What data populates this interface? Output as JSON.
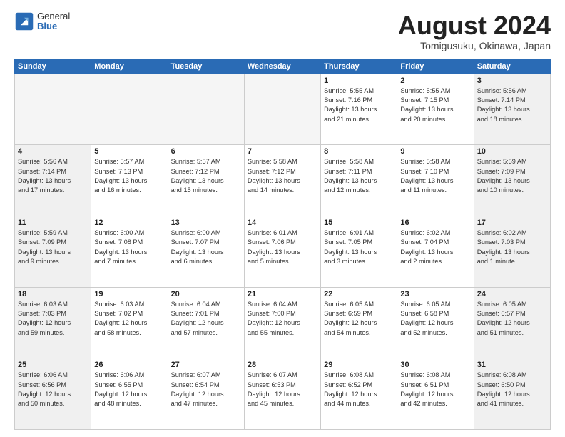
{
  "logo": {
    "general": "General",
    "blue": "Blue"
  },
  "title": "August 2024",
  "location": "Tomigusuku, Okinawa, Japan",
  "weekdays": [
    "Sunday",
    "Monday",
    "Tuesday",
    "Wednesday",
    "Thursday",
    "Friday",
    "Saturday"
  ],
  "weeks": [
    [
      {
        "day": "",
        "info": ""
      },
      {
        "day": "",
        "info": ""
      },
      {
        "day": "",
        "info": ""
      },
      {
        "day": "",
        "info": ""
      },
      {
        "day": "1",
        "info": "Sunrise: 5:55 AM\nSunset: 7:16 PM\nDaylight: 13 hours\nand 21 minutes."
      },
      {
        "day": "2",
        "info": "Sunrise: 5:55 AM\nSunset: 7:15 PM\nDaylight: 13 hours\nand 20 minutes."
      },
      {
        "day": "3",
        "info": "Sunrise: 5:56 AM\nSunset: 7:14 PM\nDaylight: 13 hours\nand 18 minutes."
      }
    ],
    [
      {
        "day": "4",
        "info": "Sunrise: 5:56 AM\nSunset: 7:14 PM\nDaylight: 13 hours\nand 17 minutes."
      },
      {
        "day": "5",
        "info": "Sunrise: 5:57 AM\nSunset: 7:13 PM\nDaylight: 13 hours\nand 16 minutes."
      },
      {
        "day": "6",
        "info": "Sunrise: 5:57 AM\nSunset: 7:12 PM\nDaylight: 13 hours\nand 15 minutes."
      },
      {
        "day": "7",
        "info": "Sunrise: 5:58 AM\nSunset: 7:12 PM\nDaylight: 13 hours\nand 14 minutes."
      },
      {
        "day": "8",
        "info": "Sunrise: 5:58 AM\nSunset: 7:11 PM\nDaylight: 13 hours\nand 12 minutes."
      },
      {
        "day": "9",
        "info": "Sunrise: 5:58 AM\nSunset: 7:10 PM\nDaylight: 13 hours\nand 11 minutes."
      },
      {
        "day": "10",
        "info": "Sunrise: 5:59 AM\nSunset: 7:09 PM\nDaylight: 13 hours\nand 10 minutes."
      }
    ],
    [
      {
        "day": "11",
        "info": "Sunrise: 5:59 AM\nSunset: 7:09 PM\nDaylight: 13 hours\nand 9 minutes."
      },
      {
        "day": "12",
        "info": "Sunrise: 6:00 AM\nSunset: 7:08 PM\nDaylight: 13 hours\nand 7 minutes."
      },
      {
        "day": "13",
        "info": "Sunrise: 6:00 AM\nSunset: 7:07 PM\nDaylight: 13 hours\nand 6 minutes."
      },
      {
        "day": "14",
        "info": "Sunrise: 6:01 AM\nSunset: 7:06 PM\nDaylight: 13 hours\nand 5 minutes."
      },
      {
        "day": "15",
        "info": "Sunrise: 6:01 AM\nSunset: 7:05 PM\nDaylight: 13 hours\nand 3 minutes."
      },
      {
        "day": "16",
        "info": "Sunrise: 6:02 AM\nSunset: 7:04 PM\nDaylight: 13 hours\nand 2 minutes."
      },
      {
        "day": "17",
        "info": "Sunrise: 6:02 AM\nSunset: 7:03 PM\nDaylight: 13 hours\nand 1 minute."
      }
    ],
    [
      {
        "day": "18",
        "info": "Sunrise: 6:03 AM\nSunset: 7:03 PM\nDaylight: 12 hours\nand 59 minutes."
      },
      {
        "day": "19",
        "info": "Sunrise: 6:03 AM\nSunset: 7:02 PM\nDaylight: 12 hours\nand 58 minutes."
      },
      {
        "day": "20",
        "info": "Sunrise: 6:04 AM\nSunset: 7:01 PM\nDaylight: 12 hours\nand 57 minutes."
      },
      {
        "day": "21",
        "info": "Sunrise: 6:04 AM\nSunset: 7:00 PM\nDaylight: 12 hours\nand 55 minutes."
      },
      {
        "day": "22",
        "info": "Sunrise: 6:05 AM\nSunset: 6:59 PM\nDaylight: 12 hours\nand 54 minutes."
      },
      {
        "day": "23",
        "info": "Sunrise: 6:05 AM\nSunset: 6:58 PM\nDaylight: 12 hours\nand 52 minutes."
      },
      {
        "day": "24",
        "info": "Sunrise: 6:05 AM\nSunset: 6:57 PM\nDaylight: 12 hours\nand 51 minutes."
      }
    ],
    [
      {
        "day": "25",
        "info": "Sunrise: 6:06 AM\nSunset: 6:56 PM\nDaylight: 12 hours\nand 50 minutes."
      },
      {
        "day": "26",
        "info": "Sunrise: 6:06 AM\nSunset: 6:55 PM\nDaylight: 12 hours\nand 48 minutes."
      },
      {
        "day": "27",
        "info": "Sunrise: 6:07 AM\nSunset: 6:54 PM\nDaylight: 12 hours\nand 47 minutes."
      },
      {
        "day": "28",
        "info": "Sunrise: 6:07 AM\nSunset: 6:53 PM\nDaylight: 12 hours\nand 45 minutes."
      },
      {
        "day": "29",
        "info": "Sunrise: 6:08 AM\nSunset: 6:52 PM\nDaylight: 12 hours\nand 44 minutes."
      },
      {
        "day": "30",
        "info": "Sunrise: 6:08 AM\nSunset: 6:51 PM\nDaylight: 12 hours\nand 42 minutes."
      },
      {
        "day": "31",
        "info": "Sunrise: 6:08 AM\nSunset: 6:50 PM\nDaylight: 12 hours\nand 41 minutes."
      }
    ]
  ]
}
